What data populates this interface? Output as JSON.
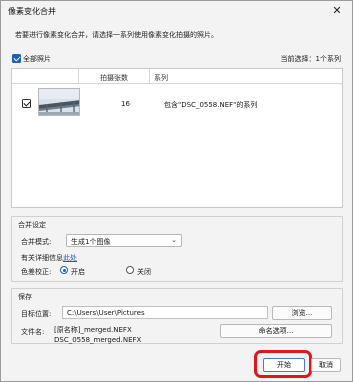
{
  "window": {
    "title": "像素变化合并",
    "close": "✕"
  },
  "description": "若要进行像素变化合并，请选择一系列使用像素变化拍摄的照片。",
  "selection": {
    "all_photos_label": "全部照片",
    "all_photos_checked": true,
    "current_selection": "当前选择：1个系列"
  },
  "table": {
    "headers": [
      "拍摄张数",
      "系列"
    ],
    "rows": [
      {
        "checked": true,
        "count": "16",
        "series": "包含\"DSC_0558.NEF\"的系列"
      }
    ]
  },
  "merge_settings": {
    "title": "合并设定",
    "mode_label": "合并模式:",
    "mode_value": "生成1个图像",
    "more_info_text": "有关详细信息",
    "more_info_link": "此处",
    "color_correction_label": "色差校正:",
    "option_on": "开启",
    "option_off": "关闭",
    "selected": "开启"
  },
  "save": {
    "title": "保存",
    "dest_label": "目标位置:",
    "dest_path": "C:\\Users\\User\\Pictures",
    "browse_button": "浏览...",
    "filename_label": "文件名:",
    "filename_pattern": "[原名称]_merged.NEFX",
    "filename_example": "DSC_0558_merged.NEFX",
    "naming_button": "命名选项..."
  },
  "footer": {
    "start_button": "开始",
    "cancel_button": "取消"
  },
  "colors": {
    "accent": "#1f5fbf",
    "highlight": "#e0161d",
    "link": "#1a5fb4"
  }
}
